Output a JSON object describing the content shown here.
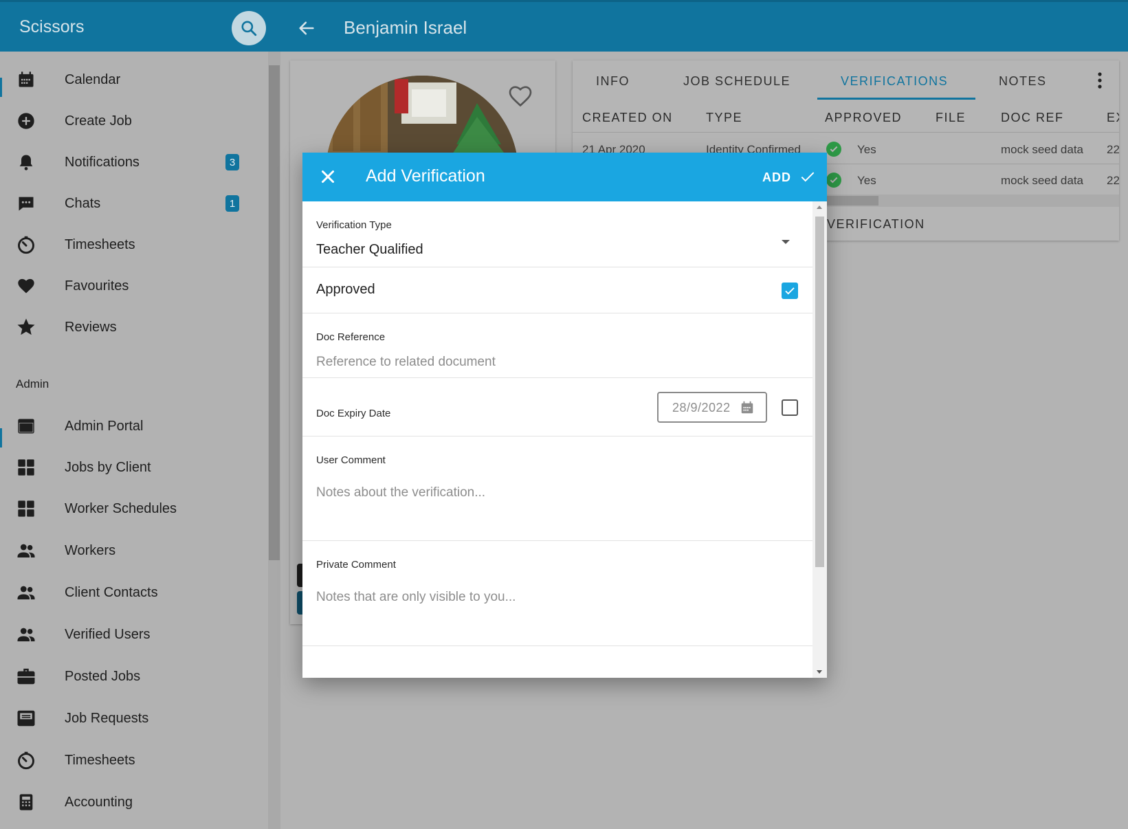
{
  "app": {
    "title": "Scissors",
    "page_title": "Benjamin Israel",
    "colors": {
      "primary": "#10749e",
      "accent": "#1aa6e1",
      "success": "#2e9a47"
    }
  },
  "sidebar": {
    "items": [
      {
        "label": "Calendar",
        "icon": "calendar-icon"
      },
      {
        "label": "Create Job",
        "icon": "add-circle-icon"
      },
      {
        "label": "Notifications",
        "icon": "bell-icon",
        "badge": "3"
      },
      {
        "label": "Chats",
        "icon": "chat-icon",
        "badge": "1"
      },
      {
        "label": "Timesheets",
        "icon": "timer-icon"
      },
      {
        "label": "Favourites",
        "icon": "heart-icon"
      },
      {
        "label": "Reviews",
        "icon": "star-icon"
      }
    ],
    "admin_heading": "Admin",
    "admin_items": [
      {
        "label": "Admin Portal",
        "icon": "web-icon"
      },
      {
        "label": "Jobs by Client",
        "icon": "grid-icon"
      },
      {
        "label": "Worker Schedules",
        "icon": "grid-icon"
      },
      {
        "label": "Workers",
        "icon": "people-icon"
      },
      {
        "label": "Client Contacts",
        "icon": "people-icon"
      },
      {
        "label": "Verified Users",
        "icon": "people-icon"
      },
      {
        "label": "Posted Jobs",
        "icon": "briefcase-icon"
      },
      {
        "label": "Job Requests",
        "icon": "inbox-icon"
      },
      {
        "label": "Timesheets",
        "icon": "timer-icon"
      },
      {
        "label": "Accounting",
        "icon": "calculator-icon"
      }
    ]
  },
  "tabs": [
    "INFO",
    "JOB SCHEDULE",
    "VERIFICATIONS",
    "NOTES"
  ],
  "active_tab": "VERIFICATIONS",
  "table": {
    "headers": [
      "CREATED ON",
      "TYPE",
      "APPROVED",
      "FILE",
      "DOC REF",
      "EX"
    ],
    "rows": [
      {
        "created_on": "21 Apr 2020",
        "type": "Identity Confirmed",
        "approved": "Yes",
        "doc_ref": "mock seed data",
        "ex": "22"
      },
      {
        "approved": "Yes",
        "doc_ref": "mock seed data",
        "ex": "22"
      }
    ],
    "add_button": "VERIFICATION"
  },
  "dialog": {
    "title": "Add Verification",
    "add_label": "ADD",
    "verification_type": {
      "label": "Verification Type",
      "value": "Teacher Qualified"
    },
    "approved": {
      "label": "Approved",
      "checked": true
    },
    "doc_reference": {
      "label": "Doc Reference",
      "placeholder": "Reference to related document"
    },
    "doc_expiry": {
      "label": "Doc Expiry Date",
      "value": "28/9/2022",
      "enabled": false
    },
    "user_comment": {
      "label": "User Comment",
      "placeholder": "Notes about the verification..."
    },
    "private_comment": {
      "label": "Private Comment",
      "placeholder": "Notes that are only visible to you..."
    }
  }
}
